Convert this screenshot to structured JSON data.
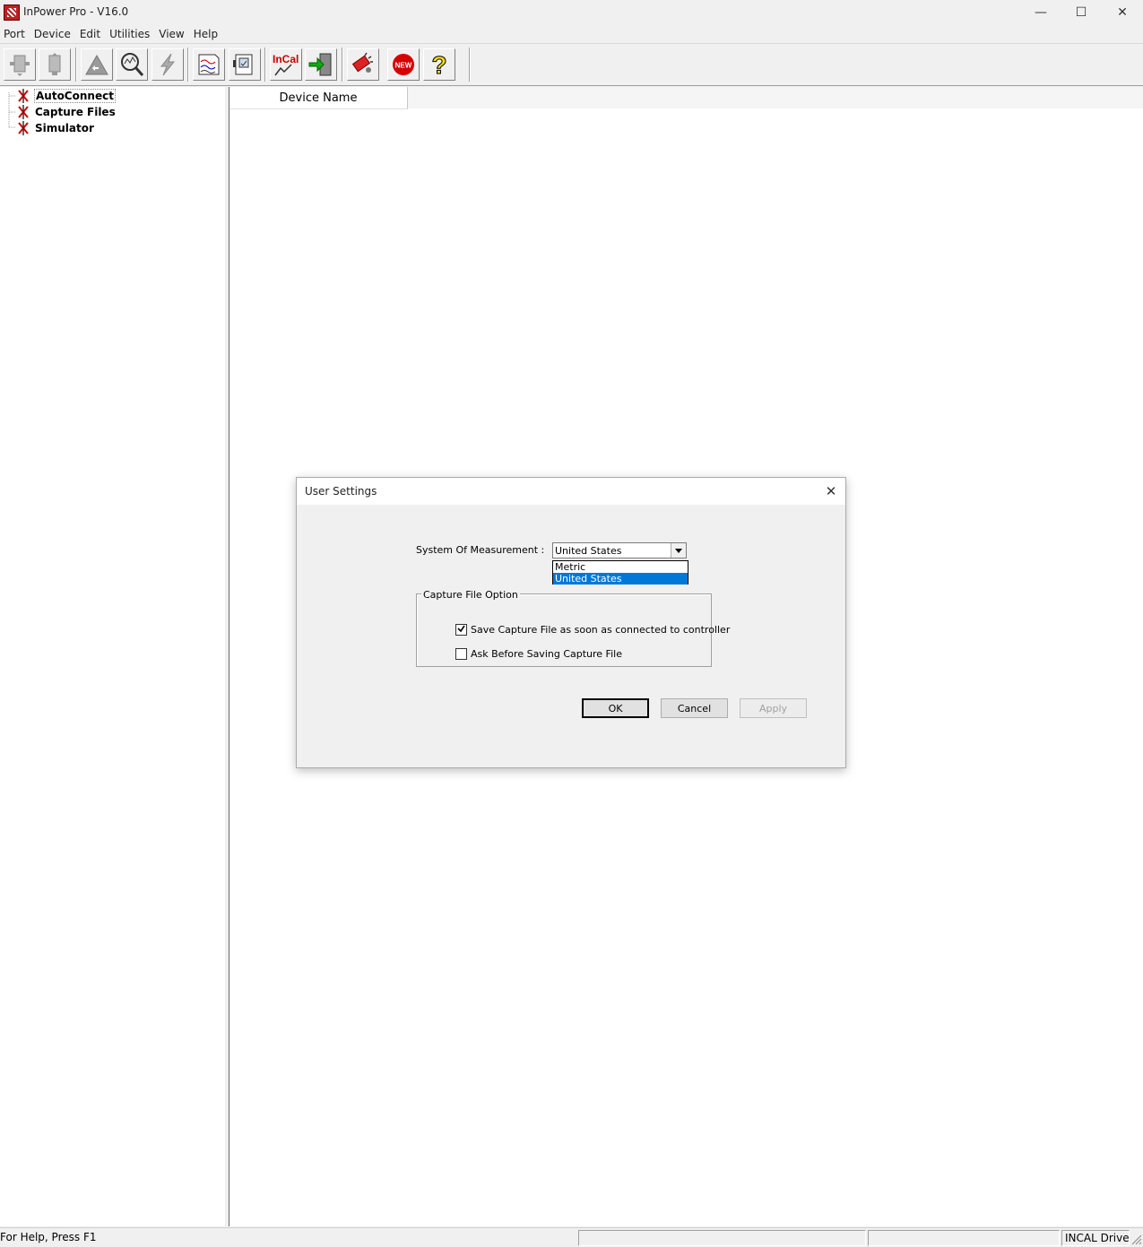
{
  "window": {
    "title": "InPower Pro - V16.0",
    "minimize": "—",
    "maximize": "☐",
    "close": "✕"
  },
  "menu": [
    "Port",
    "Device",
    "Edit",
    "Utilities",
    "View",
    "Help"
  ],
  "toolbar": {
    "icons": [
      "connect-icon",
      "disconnect-icon",
      "upload-icon",
      "inspect-icon",
      "flash-icon",
      "trend-icon",
      "monitor-icon",
      "incal-icon",
      "export-icon",
      "tools-icon",
      "new-icon",
      "help-icon"
    ],
    "incal_label": "InCal",
    "new_label": "NEW",
    "help_label": "?"
  },
  "tree": {
    "items": [
      {
        "label": "AutoConnect"
      },
      {
        "label": "Capture Files"
      },
      {
        "label": "Simulator"
      }
    ]
  },
  "list": {
    "columns": [
      "Device Name"
    ]
  },
  "status": {
    "help": "For Help, Press F1",
    "drive": "INCAL Drive:"
  },
  "dialog": {
    "title": "User Settings",
    "close": "✕",
    "measure_label": "System Of Measurement :",
    "measure_value": "United States",
    "measure_options": [
      "Metric",
      "United States"
    ],
    "selected_option_index": 1,
    "group_label": "Capture File Option",
    "checks": [
      {
        "label": "Save Capture File as soon as connected to controller",
        "checked": true
      },
      {
        "label": "Ask Before Saving Capture File",
        "checked": false
      }
    ],
    "buttons": {
      "ok": "OK",
      "cancel": "Cancel",
      "apply": "Apply"
    }
  },
  "colors": {
    "selection": "#0078d7",
    "tree_icon": "#cc0000"
  }
}
